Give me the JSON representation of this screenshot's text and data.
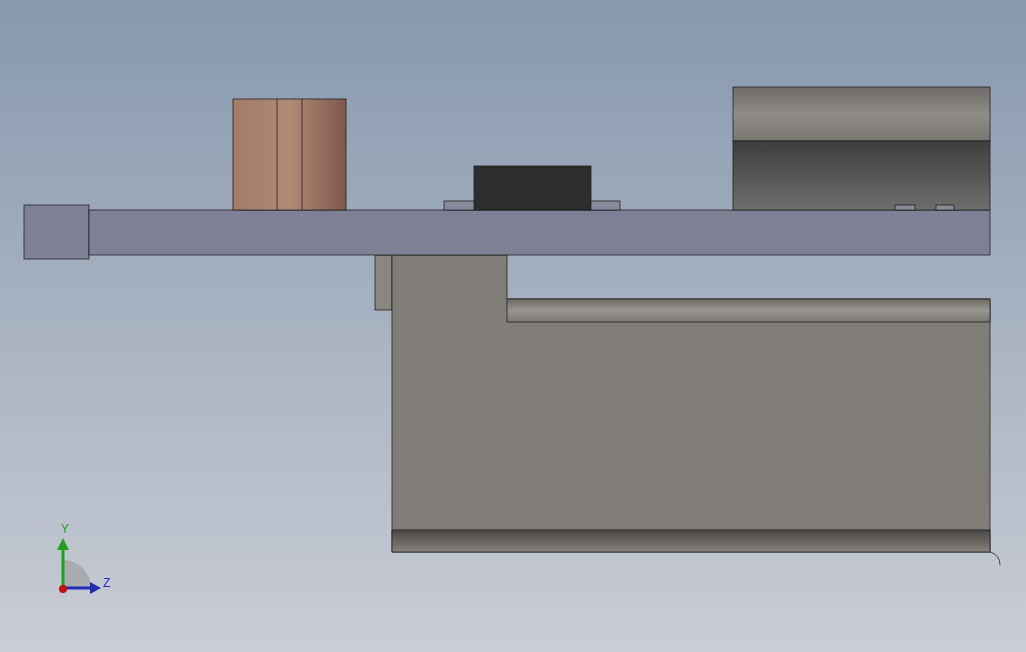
{
  "triad": {
    "y_label": "Y",
    "z_label": "Z"
  }
}
